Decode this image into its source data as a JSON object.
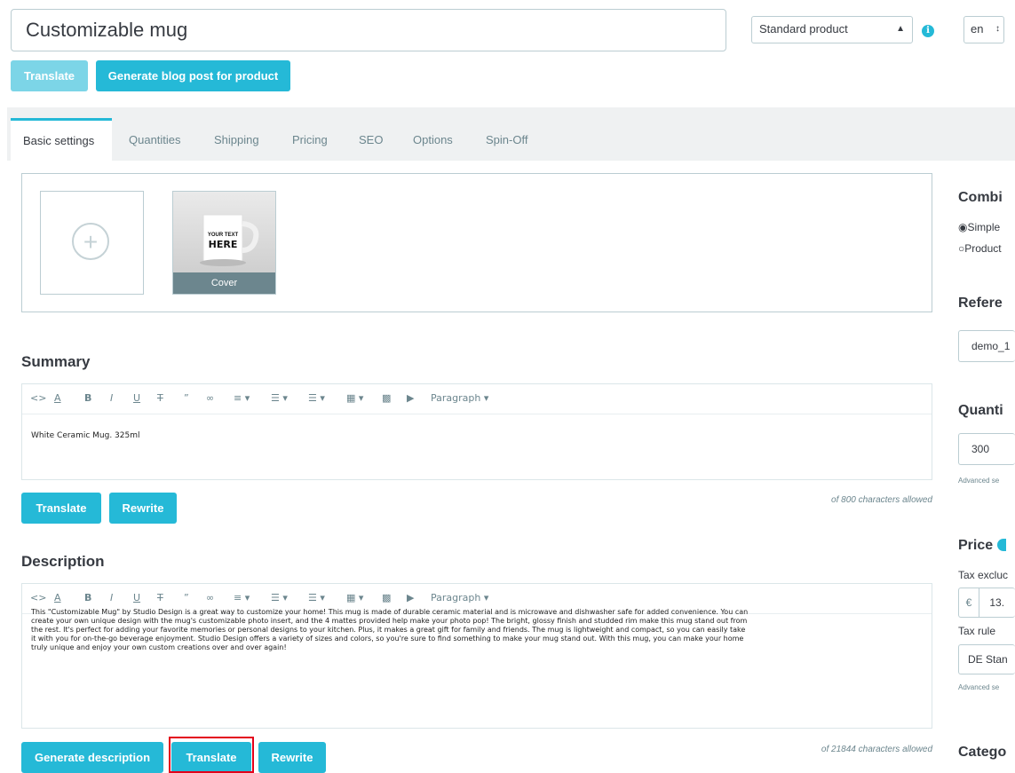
{
  "header": {
    "product_name": "Customizable mug",
    "product_type": "Standard product",
    "language": "en",
    "translate_label": "Translate",
    "blog_post_label": "Generate blog post for product"
  },
  "tabs": [
    "Basic settings",
    "Quantities",
    "Shipping",
    "Pricing",
    "SEO",
    "Options",
    "Spin-Off"
  ],
  "images": {
    "cover_label": "Cover",
    "mug_text_1": "YOUR TEXT",
    "mug_text_2": "HERE"
  },
  "summary": {
    "title": "Summary",
    "text": "White Ceramic Mug. 325ml",
    "translate_label": "Translate",
    "rewrite_label": "Rewrite",
    "counter": "of 800 characters allowed"
  },
  "description": {
    "title": "Description",
    "lines": [
      "This \"Customizable Mug\" by Studio Design is a great way to customize your home! This mug is made of durable ceramic material and is microwave and dishwasher safe for added convenience. You can",
      "create your own unique design with the mug's customizable photo insert, and the 4 mattes provided help make your photo pop! The bright, glossy finish and studded rim make this mug stand out from",
      "the rest. It's perfect for adding your favorite memories or personal designs to your kitchen. Plus, it makes a great gift for family and friends. The mug is lightweight and compact, so you can easily take",
      "it with you for on-the-go beverage enjoyment. Studio Design offers a variety of sizes and colors, so you're sure to find something to make your mug stand out. With this mug, you can make your home",
      "truly unique and enjoy your own custom creations over and over again!"
    ],
    "generate_label": "Generate description",
    "translate_label": "Translate",
    "rewrite_label": "Rewrite",
    "counter": "of 21844 characters allowed"
  },
  "editor_toolbar": {
    "paragraph_label": "Paragraph"
  },
  "right_column": {
    "combinations_title": "Combi",
    "simple_label": "Simple",
    "product_label": "Product",
    "reference_title": "Refere",
    "reference_value": "demo_1",
    "quantity_title": "Quanti",
    "quantity_value": "300",
    "advanced_1": "Advanced se",
    "price_title": "Price",
    "tax_excluded_label": "Tax excluc",
    "currency": "€",
    "price_value": "13.",
    "tax_rule_label": "Tax rule",
    "tax_rule_value": "DE Stan",
    "advanced_2": "Advanced se",
    "category_title": "Catego"
  },
  "colors": {
    "accent": "#25b9d7",
    "highlight": "#e3001b"
  }
}
